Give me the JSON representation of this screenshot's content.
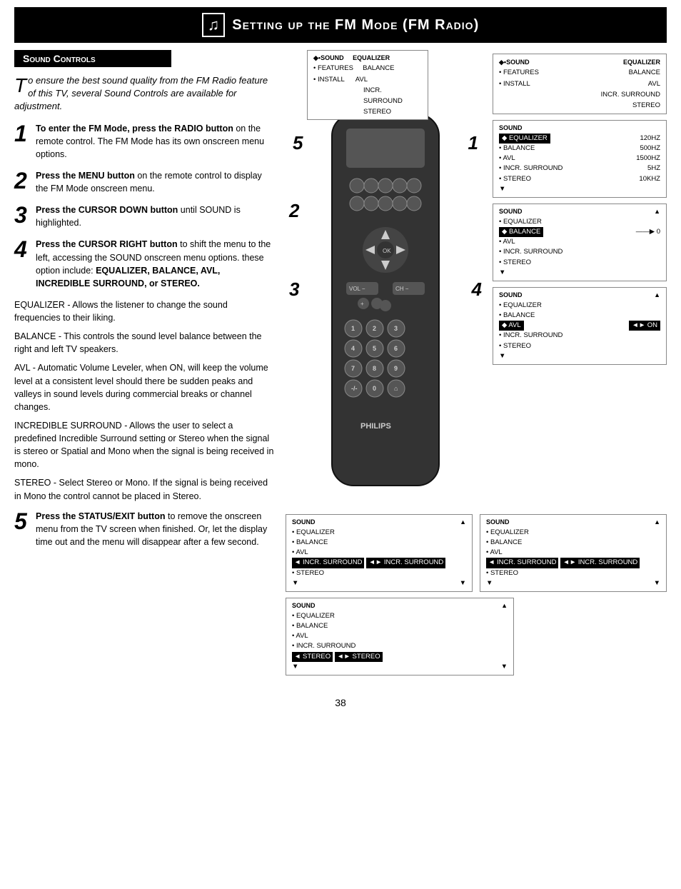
{
  "header": {
    "title": "Setting up the FM Mode (FM Radio)",
    "music_icon": "♫"
  },
  "section": {
    "title": "Sound Controls"
  },
  "intro": {
    "drop_cap": "T",
    "text": "o ensure the best sound quality from the FM Radio feature of this TV, several Sound Controls are available for adjustment."
  },
  "steps": [
    {
      "number": "1",
      "text": "To enter the FM Mode, press the RADIO button on the remote control. The FM Mode has its own onscreen menu options."
    },
    {
      "number": "2",
      "text": "Press the MENU button on the remote control to display the FM Mode onscreen menu."
    },
    {
      "number": "3",
      "text": "Press the CURSOR DOWN button until SOUND is highlighted."
    },
    {
      "number": "4",
      "text": "Press the CURSOR RIGHT button to shift the menu to the left, accessing the SOUND onscreen menu options. these option include: EQUALIZER, BALANCE, AVL, INCREDIBLE SURROUND, or STEREO."
    },
    {
      "number": "5",
      "text": "Press the STATUS/EXIT button to remove the onscreen menu from the TV screen when finished. Or, let the display time out and the menu will disappear after a few second."
    }
  ],
  "descriptions": [
    {
      "term": "EQUALIZER",
      "text": "- Allows the listener to change the sound frequencies to their liking."
    },
    {
      "term": "BALANCE",
      "text": "- This controls the sound level balance between the right and left TV speakers."
    },
    {
      "term": "AVL",
      "text": "- Automatic Volume Leveler, when ON, will keep the volume level at a consistent level should there be sudden peaks and valleys in sound levels during commercial breaks or channel changes."
    },
    {
      "term": "INCREDIBLE SURROUND",
      "text": "- Allows the user to select a predefined Incredible Surround setting or Stereo when the signal is stereo or Spatial and Mono when the signal is being received in mono."
    },
    {
      "term": "STEREO",
      "text": "- Select Stereo or Mono. If the signal is being received in Mono the control cannot be placed in Stereo."
    }
  ],
  "menu_initial_top": {
    "title": "◆•SOUND",
    "items": [
      "EQUALIZER",
      "BALANCE",
      "AVL",
      "INCR. SURROUND",
      "STEREO"
    ]
  },
  "menu_initial_right": {
    "title": "◆•SOUND",
    "features": "• FEATURES",
    "install": "• INSTALL",
    "items": [
      "EQUALIZER",
      "BALANCE",
      "AVL",
      "INCR. SURROUND",
      "STEREO"
    ]
  },
  "menu_equalizer": {
    "title": "SOUND",
    "active": "◆ EQUALIZER",
    "items": [
      "• BALANCE",
      "• AVL",
      "• INCR. SURROUND",
      "• STEREO"
    ],
    "eq_values": [
      "120HZ",
      "500HZ",
      "1500HZ",
      "5HZ",
      "10KHZ"
    ]
  },
  "menu_balance": {
    "title": "SOUND",
    "items": [
      "• EQUALIZER",
      "• AVL",
      "• INCR. SURROUND",
      "• STEREO"
    ],
    "active": "◆ BALANCE",
    "bar_value": "0"
  },
  "menu_avl": {
    "title": "SOUND",
    "items": [
      "• EQUALIZER",
      "• BALANCE",
      "• INCR. SURROUND",
      "• STEREO"
    ],
    "active": "◆ AVL",
    "value": "ON"
  },
  "menu_incr_bottom_left": {
    "title": "SOUND",
    "items": [
      "• EQUALIZER",
      "• BALANCE",
      "• AVL",
      "• STEREO"
    ],
    "active": "◄ INCR. SURROUND",
    "value": "◄► INCR. SURROUND"
  },
  "menu_incr_bottom_right": {
    "title": "SOUND",
    "items": [
      "• EQUALIZER",
      "• BALANCE",
      "• AVL",
      "• STEREO"
    ],
    "active": "◄ INCR. SURROUND",
    "value": "◄► INCR. SURROUND"
  },
  "menu_stereo_bottom": {
    "title": "SOUND",
    "items": [
      "• EQUALIZER",
      "• BALANCE",
      "• AVL",
      "• INCR. SURROUND"
    ],
    "active": "◄ STEREO",
    "value": "◄► STEREO"
  },
  "page_number": "38"
}
